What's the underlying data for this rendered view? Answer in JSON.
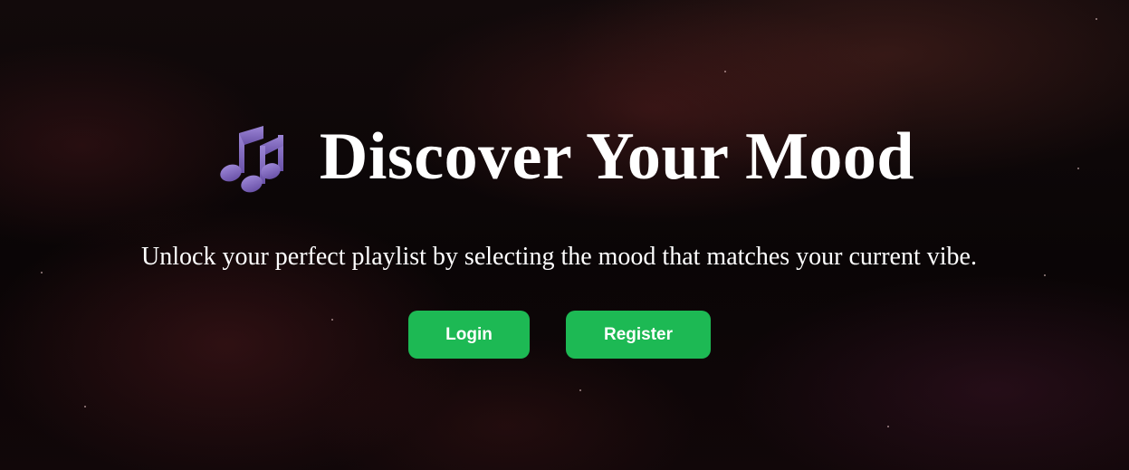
{
  "hero": {
    "icon": "musical-notes-icon",
    "title": "Discover Your Mood",
    "subtitle": "Unlock your perfect playlist by selecting the mood that matches your current vibe."
  },
  "actions": {
    "login_label": "Login",
    "register_label": "Register"
  },
  "colors": {
    "accent": "#1db954",
    "icon": "#7b63b8",
    "text": "#ffffff",
    "background": "#0b0607"
  }
}
